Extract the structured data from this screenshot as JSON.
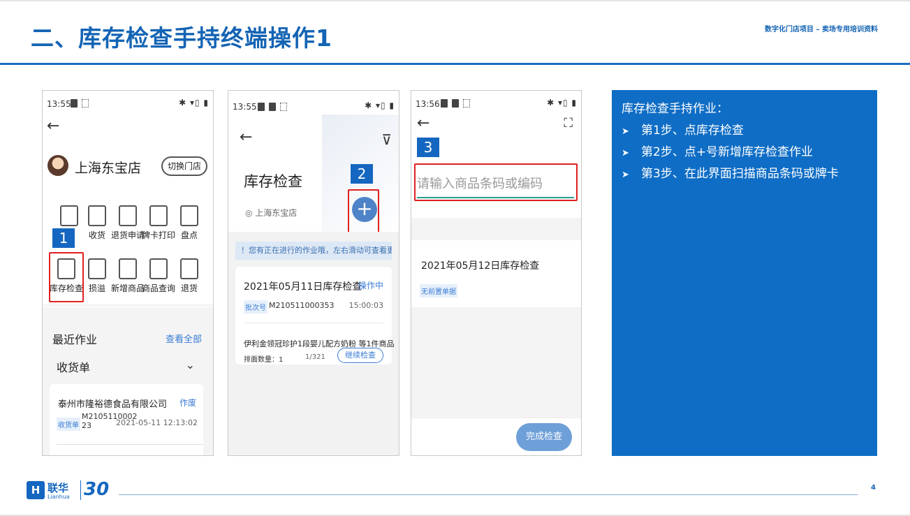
{
  "slide": {
    "title": "二、库存检查手持终端操作1",
    "subtitle": "数字化门店项目 – 卖场专用培训资料",
    "page_number": "4"
  },
  "phone1": {
    "time": "13:55",
    "store_name": "上海东宝店",
    "switch_store": "切换门店",
    "apps_row1": [
      "",
      "收货",
      "退货申请",
      "牌卡打印",
      "盘点"
    ],
    "apps_row2": [
      "库存检查",
      "损溢",
      "新增商品",
      "商品查询",
      "退货"
    ],
    "step": "1",
    "recent_label": "最近作业",
    "view_all": "查看全部",
    "receipt_label": "收货单",
    "card": {
      "company": "泰州市隆裕德食品有限公司",
      "status": "作废",
      "tag": "收货单",
      "code": "M2105110002 23",
      "time": "2021-05-11 12:13:02"
    }
  },
  "phone2": {
    "time": "13:55",
    "title": "库存检查",
    "location": "上海东宝店",
    "step": "2",
    "notice": "！您有正在进行的作业哦，左右滑动可查看更",
    "card": {
      "title": "2021年05月11日库存检查",
      "status": "操作中",
      "tag": "批次号",
      "batch": "M210511000353",
      "time": "15:00:03",
      "product": "伊利金领冠珍护1段婴儿配方奶粉  等1件商品",
      "qty": "排面数量：1",
      "page": "1/321",
      "continue": "继续检查"
    }
  },
  "phone3": {
    "time": "13:56",
    "step": "3",
    "input_placeholder": "请输入商品条码或编码",
    "title": "2021年05月12日库存检查",
    "tag": "无前置单据",
    "finish": "完成检查"
  },
  "panel": {
    "heading": "库存检查手持作业：",
    "steps": [
      "第1步、点库存检查",
      "第2步、点+号新增库存检查作业",
      "第3步、在此界面扫描商品条码或牌卡"
    ]
  },
  "footer": {
    "logo_cn": "联华",
    "logo_en": "Lianhua",
    "logo_30": "30"
  }
}
